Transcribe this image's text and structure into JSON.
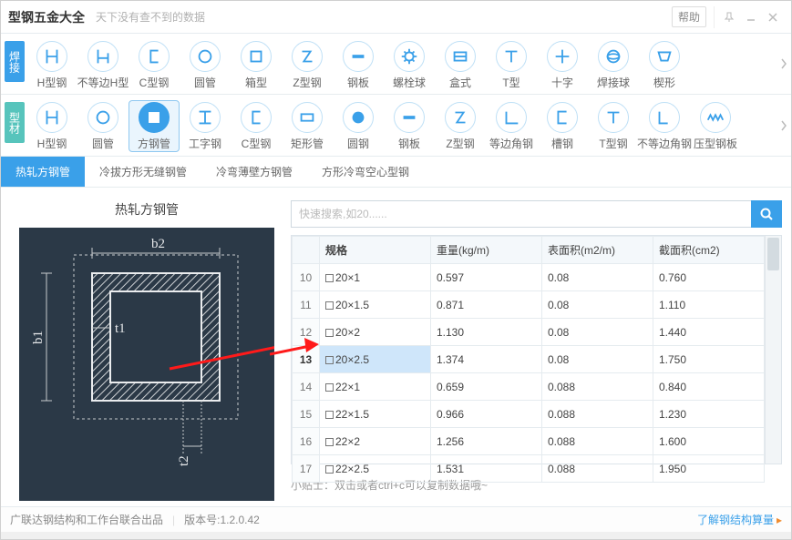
{
  "window": {
    "title": "型钢五金大全",
    "subtitle": "天下没有查不到的数据",
    "help": "帮助"
  },
  "row1": {
    "label": "焊接",
    "items": [
      {
        "label": "H型钢"
      },
      {
        "label": "不等边H型"
      },
      {
        "label": "C型钢"
      },
      {
        "label": "圆管"
      },
      {
        "label": "箱型"
      },
      {
        "label": "Z型钢"
      },
      {
        "label": "钢板"
      },
      {
        "label": "螺栓球"
      },
      {
        "label": "盒式"
      },
      {
        "label": "T型"
      },
      {
        "label": "十字"
      },
      {
        "label": "焊接球"
      },
      {
        "label": "楔形"
      }
    ]
  },
  "row2": {
    "label": "型材",
    "items": [
      {
        "label": "H型钢"
      },
      {
        "label": "圆管"
      },
      {
        "label": "方钢管"
      },
      {
        "label": "工字钢"
      },
      {
        "label": "C型钢"
      },
      {
        "label": "矩形管"
      },
      {
        "label": "圆钢"
      },
      {
        "label": "钢板"
      },
      {
        "label": "Z型钢"
      },
      {
        "label": "等边角钢"
      },
      {
        "label": "槽钢"
      },
      {
        "label": "T型钢"
      },
      {
        "label": "不等边角钢"
      },
      {
        "label": "压型钢板"
      }
    ],
    "selected": 2
  },
  "subtabs": {
    "items": [
      "热轧方钢管",
      "冷拔方形无缝钢管",
      "冷弯薄壁方钢管",
      "方形冷弯空心型钢"
    ],
    "active": 0
  },
  "diagram": {
    "title": "热轧方钢管",
    "labels": {
      "b1": "b1",
      "b2": "b2",
      "t1": "t1",
      "t2": "t2"
    }
  },
  "search": {
    "placeholder": "快速搜索,如20......"
  },
  "table": {
    "headers": [
      "规格",
      "重量(kg/m)",
      "表面积(m2/m)",
      "截面积(cm2)"
    ],
    "rows": [
      {
        "idx": 10,
        "spec": "20×1",
        "w": "0.597",
        "a": "0.08",
        "s": "0.760"
      },
      {
        "idx": 11,
        "spec": "20×1.5",
        "w": "0.871",
        "a": "0.08",
        "s": "1.110"
      },
      {
        "idx": 12,
        "spec": "20×2",
        "w": "1.130",
        "a": "0.08",
        "s": "1.440"
      },
      {
        "idx": 13,
        "spec": "20×2.5",
        "w": "1.374",
        "a": "0.08",
        "s": "1.750"
      },
      {
        "idx": 14,
        "spec": "22×1",
        "w": "0.659",
        "a": "0.088",
        "s": "0.840"
      },
      {
        "idx": 15,
        "spec": "22×1.5",
        "w": "0.966",
        "a": "0.088",
        "s": "1.230"
      },
      {
        "idx": 16,
        "spec": "22×2",
        "w": "1.256",
        "a": "0.088",
        "s": "1.600"
      },
      {
        "idx": 17,
        "spec": "22×2.5",
        "w": "1.531",
        "a": "0.088",
        "s": "1.950"
      }
    ],
    "selected_idx": 13
  },
  "hint": "小贴士：双击或者ctrl+c可以复制数据哦~",
  "status": {
    "left1": "广联达钢结构和工作台联合出品",
    "left2": "版本号:1.2.0.42",
    "right": "了解钢结构算量"
  }
}
